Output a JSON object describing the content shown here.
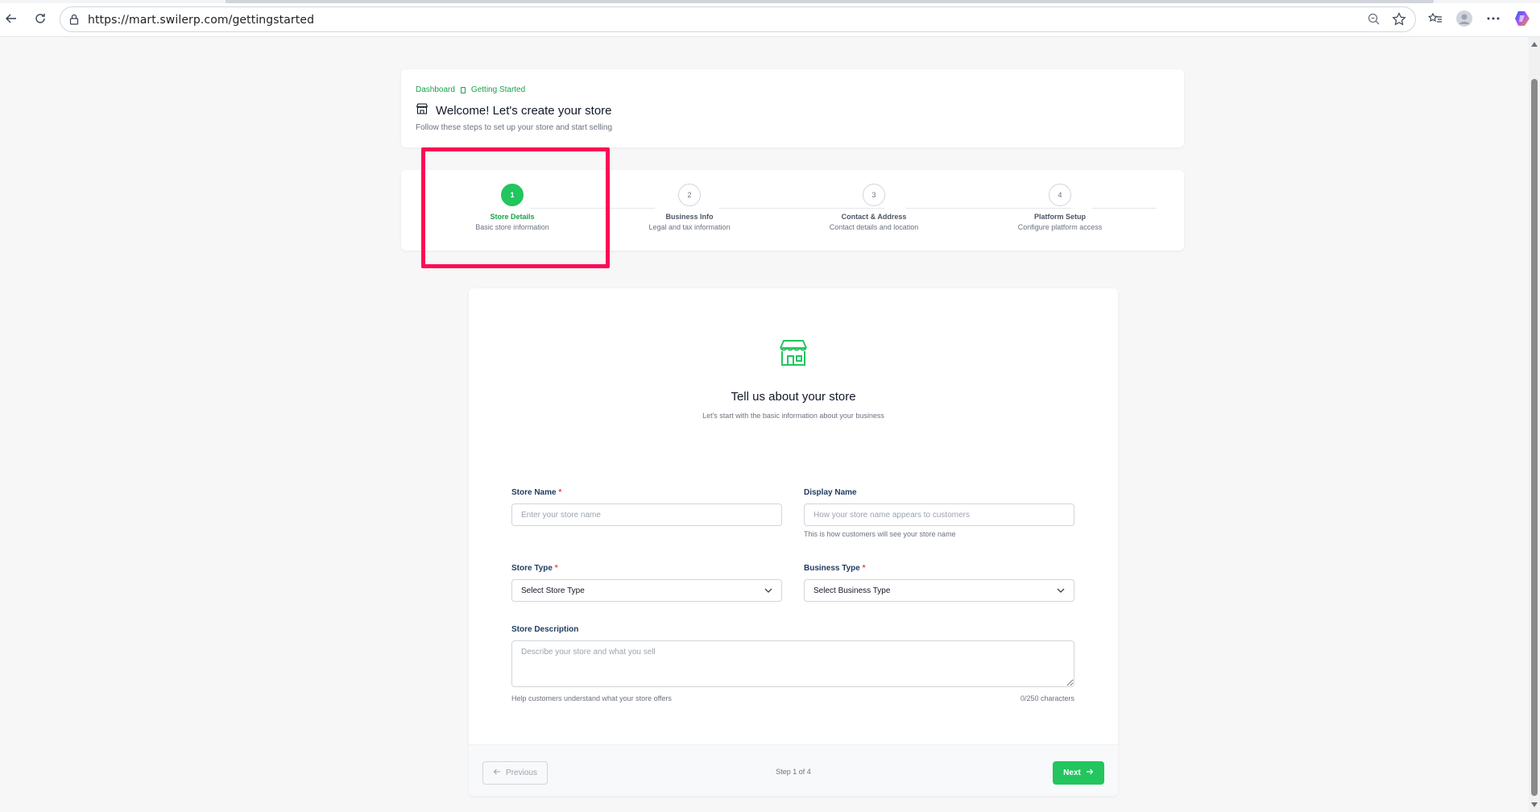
{
  "browser": {
    "url": "https://mart.swilerp.com/gettingstarted"
  },
  "header": {
    "breadcrumb": [
      "Dashboard",
      "Getting Started"
    ],
    "title": "Welcome! Let's create your store",
    "subtitle": "Follow these steps to set up your store and start selling"
  },
  "stepper": {
    "steps": [
      {
        "number": "1",
        "label": "Store Details",
        "desc": "Basic store information",
        "active": true
      },
      {
        "number": "2",
        "label": "Business Info",
        "desc": "Legal and tax information",
        "active": false
      },
      {
        "number": "3",
        "label": "Contact & Address",
        "desc": "Contact details and location",
        "active": false
      },
      {
        "number": "4",
        "label": "Platform Setup",
        "desc": "Configure platform access",
        "active": false
      }
    ]
  },
  "form": {
    "icon": "store-icon",
    "title": "Tell us about your store",
    "subtitle": "Let's start with the basic information about your business",
    "store_name": {
      "label": "Store Name",
      "placeholder": "Enter your store name",
      "value": ""
    },
    "display_name": {
      "label": "Display Name",
      "placeholder": "How your store name appears to customers",
      "hint": "This is how customers will see your store name",
      "value": ""
    },
    "store_type": {
      "label": "Store Type",
      "selected": "Select Store Type"
    },
    "business_type": {
      "label": "Business Type",
      "selected": "Select Business Type"
    },
    "description": {
      "label": "Store Description",
      "placeholder": "Describe your store and what you sell",
      "hint": "Help customers understand what your store offers",
      "counter": "0/250 characters"
    },
    "required_mark": "*"
  },
  "footer": {
    "previous_label": "Previous",
    "step_count": "Step 1 of 4",
    "next_label": "Next"
  },
  "colors": {
    "accent": "#22c55e",
    "accent_text": "#16a34a",
    "highlight": "#ff0a55",
    "label": "#1e3a5f"
  }
}
